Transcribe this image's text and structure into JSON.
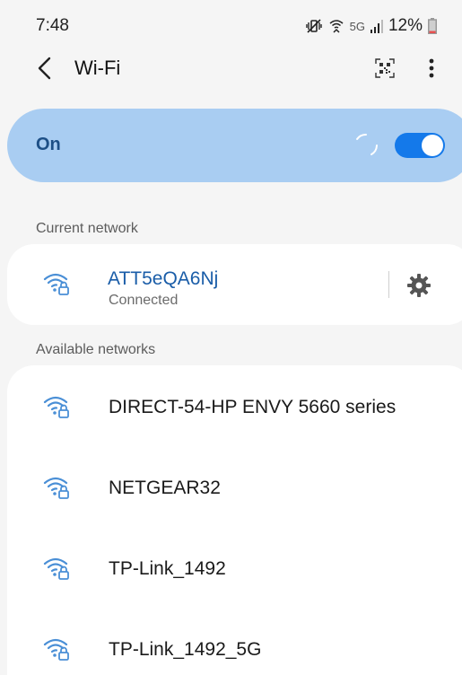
{
  "status_bar": {
    "time": "7:48",
    "network_type": "5G",
    "battery_percent": "12%",
    "battery_level": 0.12
  },
  "header": {
    "title": "Wi-Fi"
  },
  "toggle": {
    "label": "On",
    "enabled": true
  },
  "current_section": {
    "label": "Current network",
    "network": {
      "name": "ATT5eQA6Nj",
      "status": "Connected"
    }
  },
  "available_section": {
    "label": "Available networks",
    "networks": [
      {
        "name": "DIRECT-54-HP ENVY 5660 series"
      },
      {
        "name": "NETGEAR32"
      },
      {
        "name": "TP-Link_1492"
      },
      {
        "name": "TP-Link_1492_5G"
      }
    ]
  },
  "colors": {
    "accent": "#1479ea",
    "toggle_card": "#a9cdf2",
    "connected_text": "#1a5da8",
    "wifi_icon": "#4a8fd6"
  }
}
